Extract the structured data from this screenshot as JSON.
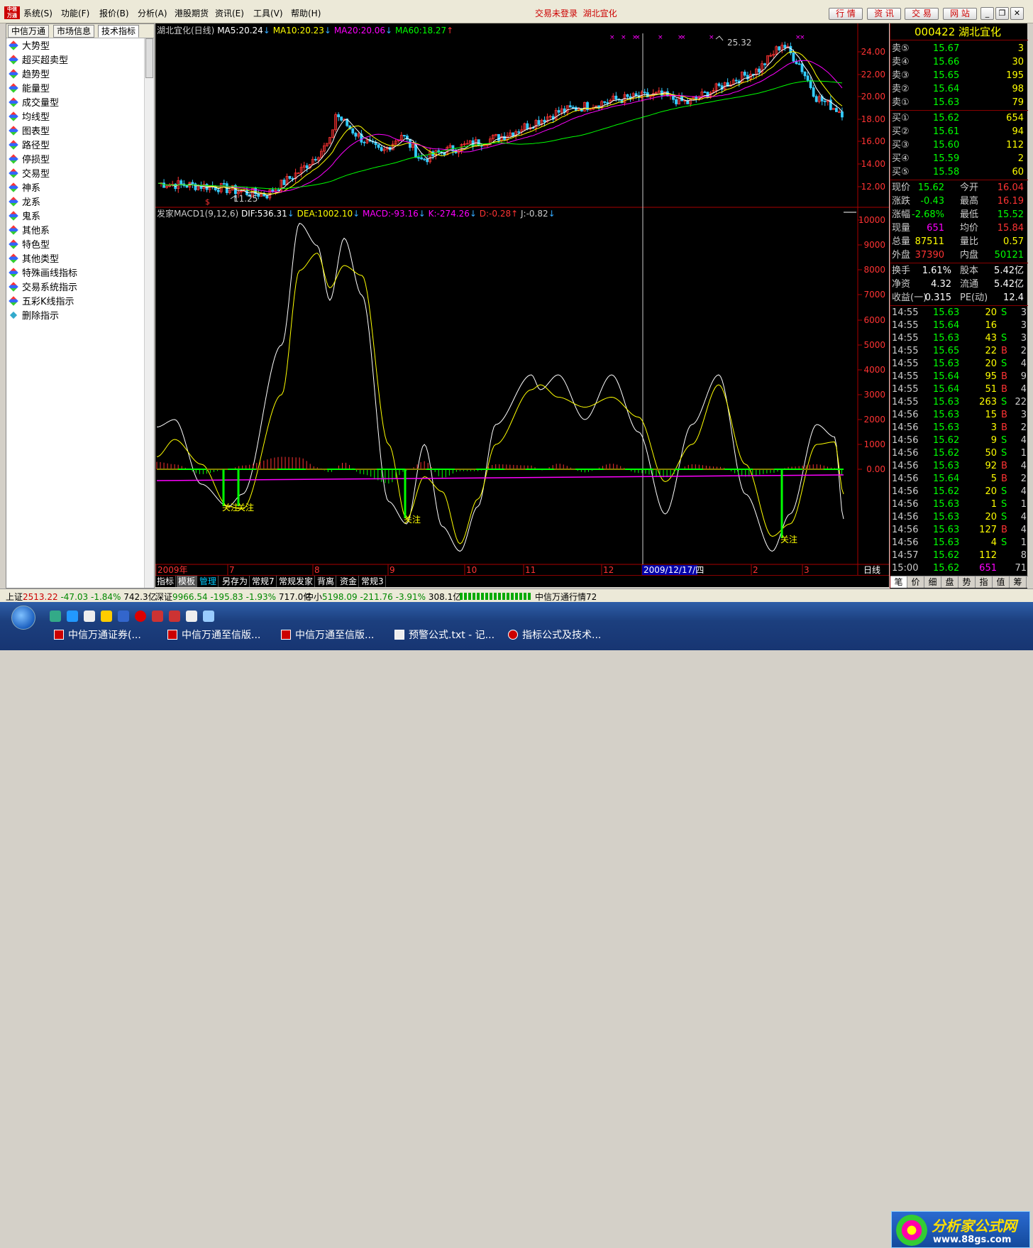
{
  "menubar": {
    "items": [
      "系统(S)",
      "功能(F)",
      "报价(B)",
      "分析(A)",
      "港股期货",
      "资讯(E)",
      "工具(V)",
      "帮助(H)"
    ],
    "status": "交易未登录",
    "stock_title": "湖北宜化",
    "buttons": [
      "行 情",
      "资 讯",
      "交 易",
      "网 站"
    ]
  },
  "left": {
    "tabs": [
      "中信万通",
      "市场信息",
      "技术指标"
    ],
    "items": [
      "大势型",
      "超买超卖型",
      "趋势型",
      "能量型",
      "成交量型",
      "均线型",
      "图表型",
      "路径型",
      "停损型",
      "交易型",
      "神系",
      "龙系",
      "鬼系",
      "其他系",
      "特色型",
      "其他类型",
      "特殊画线指标",
      "交易系统指示",
      "五彩K线指示",
      "删除指示"
    ]
  },
  "price_header": {
    "name": "湖北宜化(日线)",
    "ma5": "MA5:20.24",
    "ma10": "MA10:20.23",
    "ma20": "MA20:20.06",
    "ma60": "MA60:18.27"
  },
  "price_axis": [
    "24.00",
    "22.00",
    "20.00",
    "18.00",
    "16.00",
    "14.00",
    "12.00"
  ],
  "price_marks": {
    "high": "25.32",
    "low": "11.25"
  },
  "macd_header": {
    "name": "发家MACD1(9,12,6)",
    "dif": "DIF:536.31",
    "dea": "DEA:1002.10",
    "macd": "MACD:-93.16",
    "k": "K:-274.26",
    "d": "D:-0.28",
    "j": "J:-0.82"
  },
  "macd_axis": [
    "10000",
    "9000",
    "8000",
    "7000",
    "6000",
    "5000",
    "4000",
    "3000",
    "2000",
    "1000",
    "0.00"
  ],
  "attention_label": "关注",
  "time_axis": {
    "labels": [
      "2009年",
      "7",
      "8",
      "9",
      "10",
      "11",
      "12",
      "2009/12/17/四",
      "2",
      "3"
    ],
    "period": "日线"
  },
  "chart_tabs": [
    "指标",
    "模板",
    "管理",
    "另存为",
    "常规7",
    "常规发家",
    "背离",
    "资金",
    "常规3"
  ],
  "quote": {
    "code": "000422",
    "name": "湖北宜化",
    "sells": [
      {
        "label": "卖⑤",
        "price": "15.67",
        "vol": "3"
      },
      {
        "label": "卖④",
        "price": "15.66",
        "vol": "30"
      },
      {
        "label": "卖③",
        "price": "15.65",
        "vol": "195"
      },
      {
        "label": "卖②",
        "price": "15.64",
        "vol": "98"
      },
      {
        "label": "卖①",
        "price": "15.63",
        "vol": "79"
      }
    ],
    "buys": [
      {
        "label": "买①",
        "price": "15.62",
        "vol": "654"
      },
      {
        "label": "买②",
        "price": "15.61",
        "vol": "94"
      },
      {
        "label": "买③",
        "price": "15.60",
        "vol": "112"
      },
      {
        "label": "买④",
        "price": "15.59",
        "vol": "2"
      },
      {
        "label": "买⑤",
        "price": "15.58",
        "vol": "60"
      }
    ],
    "stats": [
      {
        "l1": "现价",
        "v1": "15.62",
        "c1": "#0f0",
        "l2": "今开",
        "v2": "16.04",
        "c2": "#f33"
      },
      {
        "l1": "涨跌",
        "v1": "-0.43",
        "c1": "#0f0",
        "l2": "最高",
        "v2": "16.19",
        "c2": "#f33"
      },
      {
        "l1": "涨幅",
        "v1": "-2.68%",
        "c1": "#0f0",
        "l2": "最低",
        "v2": "15.52",
        "c2": "#0f0"
      },
      {
        "l1": "现量",
        "v1": "651",
        "c1": "#f0f",
        "l2": "均价",
        "v2": "15.84",
        "c2": "#f33"
      },
      {
        "l1": "总量",
        "v1": "87511",
        "c1": "#ff0",
        "l2": "量比",
        "v2": "0.57",
        "c2": "#ff0"
      },
      {
        "l1": "外盘",
        "v1": "37390",
        "c1": "#f33",
        "l2": "内盘",
        "v2": "50121",
        "c2": "#0f0"
      }
    ],
    "stats2": [
      {
        "l1": "换手",
        "v1": "1.61%",
        "l2": "股本",
        "v2": "5.42亿"
      },
      {
        "l1": "净资",
        "v1": "4.32",
        "l2": "流通",
        "v2": "5.42亿"
      },
      {
        "l1": "收益(一)",
        "v1": "0.315",
        "l2": "PE(动)",
        "v2": "12.4"
      }
    ],
    "ticks": [
      {
        "t": "14:55",
        "p": "15.63",
        "v": "20",
        "bs": "S",
        "n": "3"
      },
      {
        "t": "14:55",
        "p": "15.64",
        "v": "16",
        "bs": "",
        "n": "3"
      },
      {
        "t": "14:55",
        "p": "15.63",
        "v": "43",
        "bs": "S",
        "n": "3"
      },
      {
        "t": "14:55",
        "p": "15.65",
        "v": "22",
        "bs": "B",
        "n": "2"
      },
      {
        "t": "14:55",
        "p": "15.63",
        "v": "20",
        "bs": "S",
        "n": "4"
      },
      {
        "t": "14:55",
        "p": "15.64",
        "v": "95",
        "bs": "B",
        "n": "9"
      },
      {
        "t": "14:55",
        "p": "15.64",
        "v": "51",
        "bs": "B",
        "n": "4"
      },
      {
        "t": "14:55",
        "p": "15.63",
        "v": "263",
        "bs": "S",
        "n": "22"
      },
      {
        "t": "14:56",
        "p": "15.63",
        "v": "15",
        "bs": "B",
        "n": "3"
      },
      {
        "t": "14:56",
        "p": "15.63",
        "v": "3",
        "bs": "B",
        "n": "2"
      },
      {
        "t": "14:56",
        "p": "15.62",
        "v": "9",
        "bs": "S",
        "n": "4"
      },
      {
        "t": "14:56",
        "p": "15.62",
        "v": "50",
        "bs": "S",
        "n": "1"
      },
      {
        "t": "14:56",
        "p": "15.63",
        "v": "92",
        "bs": "B",
        "n": "4"
      },
      {
        "t": "14:56",
        "p": "15.64",
        "v": "5",
        "bs": "B",
        "n": "2"
      },
      {
        "t": "14:56",
        "p": "15.62",
        "v": "20",
        "bs": "S",
        "n": "4"
      },
      {
        "t": "14:56",
        "p": "15.63",
        "v": "1",
        "bs": "S",
        "n": "1"
      },
      {
        "t": "14:56",
        "p": "15.63",
        "v": "20",
        "bs": "S",
        "n": "4"
      },
      {
        "t": "14:56",
        "p": "15.63",
        "v": "127",
        "bs": "B",
        "n": "4"
      },
      {
        "t": "14:56",
        "p": "15.63",
        "v": "4",
        "bs": "S",
        "n": "1"
      },
      {
        "t": "14:57",
        "p": "15.62",
        "v": "112",
        "bs": "",
        "n": "8"
      },
      {
        "t": "15:00",
        "p": "15.62",
        "v": "651",
        "bs": "",
        "n": "71"
      }
    ],
    "tabs": [
      "笔",
      "价",
      "细",
      "盘",
      "势",
      "指",
      "值",
      "筹"
    ]
  },
  "indexbar": {
    "sh_name": "上证",
    "sh_val": "2513.22",
    "sh_chg": "-47.03",
    "sh_pct": "-1.84%",
    "sh_amt": "742.3亿",
    "sz_name": "深证",
    "sz_val": "9966.54",
    "sz_chg": "-195.83",
    "sz_pct": "-1.93%",
    "sz_amt": "717.0亿",
    "zx_name": "中小",
    "zx_val": "5198.09",
    "zx_chg": "-211.76",
    "zx_pct": "-3.91%",
    "zx_amt": "308.1亿",
    "feed": "中信万通行情72"
  },
  "taskbar": {
    "tasks": [
      "中信万通证券(...",
      "中信万通至信版...",
      "中信万通至信版...",
      "预警公式.txt - 记...",
      "指标公式及技术..."
    ],
    "watermark1": "分析家公式网",
    "watermark2": "www.88gs.com"
  }
}
